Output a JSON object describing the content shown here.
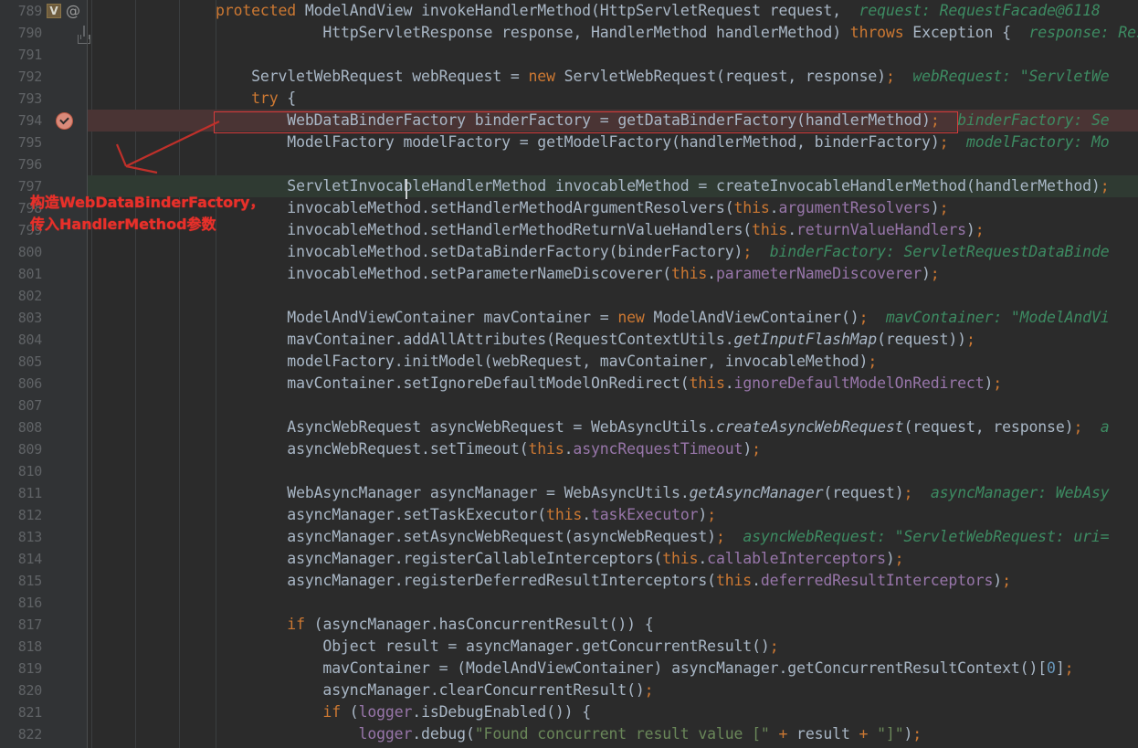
{
  "editor": {
    "app": "IntelliJ IDEA Debugger",
    "first_line": 789,
    "gutter_icons": {
      "override_label": "V",
      "annotation_label": "@"
    }
  },
  "annotation": {
    "line1": "构造WebDataBinderFactory，",
    "line2": "传入HandlerMethod参数",
    "color": "#e8302a"
  },
  "colors": {
    "background": "#2b2b2b",
    "gutter": "#313335",
    "line_number": "#606366",
    "default_text": "#a9b7c6",
    "keyword": "#cc7832",
    "field": "#9876aa",
    "string": "#6a8759",
    "inline_hint": "#3d8b62",
    "breakpoint_row": "#4a3434",
    "execution_row": "#2f3a32",
    "annotation_red": "#e8302a"
  },
  "lines": [
    {
      "num": 789,
      "indent": 0,
      "text": "protected ModelAndView invokeHandlerMethod(HttpServletRequest request,",
      "hint": "request: RequestFacade@6118"
    },
    {
      "num": 790,
      "indent": 0,
      "text": "            HttpServletResponse response, HandlerMethod handlerMethod) throws Exception {",
      "hint": "response: Res"
    },
    {
      "num": 791,
      "indent": 0,
      "text": "",
      "hint": ""
    },
    {
      "num": 792,
      "indent": 0,
      "text": "    ServletWebRequest webRequest = new ServletWebRequest(request, response);",
      "hint": "webRequest: \"ServletWe"
    },
    {
      "num": 793,
      "indent": 0,
      "text": "    try {",
      "hint": ""
    },
    {
      "num": 794,
      "indent": 0,
      "text": "        WebDataBinderFactory binderFactory = getDataBinderFactory(handlerMethod);",
      "hint": "binderFactory: Se"
    },
    {
      "num": 795,
      "indent": 0,
      "text": "        ModelFactory modelFactory = getModelFactory(handlerMethod, binderFactory);",
      "hint": "modelFactory: Mo"
    },
    {
      "num": 796,
      "indent": 0,
      "text": "",
      "hint": ""
    },
    {
      "num": 797,
      "indent": 0,
      "text": "        ServletInvocableHandlerMethod invocableMethod = createInvocableHandlerMethod(handlerMethod);",
      "hint": ""
    },
    {
      "num": 798,
      "indent": 0,
      "text": "        invocableMethod.setHandlerMethodArgumentResolvers(this.argumentResolvers);",
      "hint": ""
    },
    {
      "num": 799,
      "indent": 0,
      "text": "        invocableMethod.setHandlerMethodReturnValueHandlers(this.returnValueHandlers);",
      "hint": ""
    },
    {
      "num": 800,
      "indent": 0,
      "text": "        invocableMethod.setDataBinderFactory(binderFactory);",
      "hint": "binderFactory: ServletRequestDataBinde"
    },
    {
      "num": 801,
      "indent": 0,
      "text": "        invocableMethod.setParameterNameDiscoverer(this.parameterNameDiscoverer);",
      "hint": ""
    },
    {
      "num": 802,
      "indent": 0,
      "text": "",
      "hint": ""
    },
    {
      "num": 803,
      "indent": 0,
      "text": "        ModelAndViewContainer mavContainer = new ModelAndViewContainer();",
      "hint": "mavContainer: \"ModelAndVi"
    },
    {
      "num": 804,
      "indent": 0,
      "text": "        mavContainer.addAllAttributes(RequestContextUtils.getInputFlashMap(request));",
      "hint": ""
    },
    {
      "num": 805,
      "indent": 0,
      "text": "        modelFactory.initModel(webRequest, mavContainer, invocableMethod);",
      "hint": ""
    },
    {
      "num": 806,
      "indent": 0,
      "text": "        mavContainer.setIgnoreDefaultModelOnRedirect(this.ignoreDefaultModelOnRedirect);",
      "hint": ""
    },
    {
      "num": 807,
      "indent": 0,
      "text": "",
      "hint": ""
    },
    {
      "num": 808,
      "indent": 0,
      "text": "        AsyncWebRequest asyncWebRequest = WebAsyncUtils.createAsyncWebRequest(request, response);",
      "hint": "a"
    },
    {
      "num": 809,
      "indent": 0,
      "text": "        asyncWebRequest.setTimeout(this.asyncRequestTimeout);",
      "hint": ""
    },
    {
      "num": 810,
      "indent": 0,
      "text": "",
      "hint": ""
    },
    {
      "num": 811,
      "indent": 0,
      "text": "        WebAsyncManager asyncManager = WebAsyncUtils.getAsyncManager(request);",
      "hint": "asyncManager: WebAsy"
    },
    {
      "num": 812,
      "indent": 0,
      "text": "        asyncManager.setTaskExecutor(this.taskExecutor);",
      "hint": ""
    },
    {
      "num": 813,
      "indent": 0,
      "text": "        asyncManager.setAsyncWebRequest(asyncWebRequest);",
      "hint": "asyncWebRequest: \"ServletWebRequest: uri="
    },
    {
      "num": 814,
      "indent": 0,
      "text": "        asyncManager.registerCallableInterceptors(this.callableInterceptors);",
      "hint": ""
    },
    {
      "num": 815,
      "indent": 0,
      "text": "        asyncManager.registerDeferredResultInterceptors(this.deferredResultInterceptors);",
      "hint": ""
    },
    {
      "num": 816,
      "indent": 0,
      "text": "",
      "hint": ""
    },
    {
      "num": 817,
      "indent": 0,
      "text": "        if (asyncManager.hasConcurrentResult()) {",
      "hint": ""
    },
    {
      "num": 818,
      "indent": 0,
      "text": "            Object result = asyncManager.getConcurrentResult();",
      "hint": ""
    },
    {
      "num": 819,
      "indent": 0,
      "text": "            mavContainer = (ModelAndViewContainer) asyncManager.getConcurrentResultContext()[0];",
      "hint": ""
    },
    {
      "num": 820,
      "indent": 0,
      "text": "            asyncManager.clearConcurrentResult();",
      "hint": ""
    },
    {
      "num": 821,
      "indent": 0,
      "text": "            if (logger.isDebugEnabled()) {",
      "hint": ""
    },
    {
      "num": 822,
      "indent": 0,
      "text": "                logger.debug(\"Found concurrent result value [\" + result + \"]\");",
      "hint": ""
    }
  ],
  "highlight": {
    "breakpoint_line": 794,
    "execution_line": 797,
    "red_box_line": 794
  }
}
